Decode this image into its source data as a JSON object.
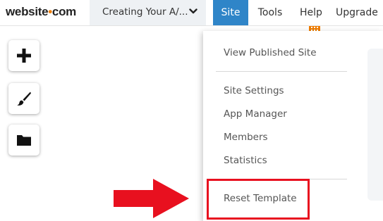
{
  "header": {
    "logo": {
      "part1": "website",
      "dot": "•",
      "part2": "com"
    },
    "site_title": "Creating Your A/...",
    "nav": {
      "site": "Site",
      "tools": "Tools",
      "help": "Help",
      "upgrade": "Upgrade"
    }
  },
  "toolbar": {
    "buttons": [
      {
        "icon": "plus-icon"
      },
      {
        "icon": "paintbrush-icon"
      },
      {
        "icon": "folder-icon"
      }
    ]
  },
  "site_menu": {
    "items": [
      "View Published Site",
      "Site Settings",
      "App Manager",
      "Members",
      "Statistics",
      "Reset Template"
    ]
  },
  "colors": {
    "accent": "#2f85c8",
    "brand_orange": "#f07d00",
    "annotation_red": "#e8101f"
  }
}
